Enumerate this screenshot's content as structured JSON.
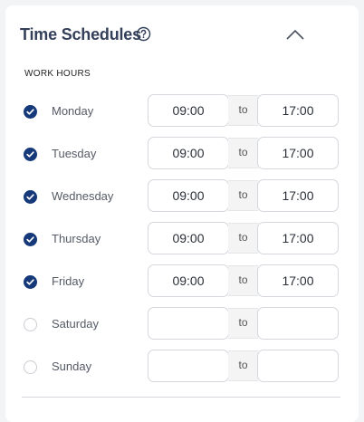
{
  "header": {
    "title": "Time Schedules"
  },
  "icons": {
    "help": "help-circle-icon",
    "collapse": "chevron-up-icon"
  },
  "section_label": "WORK HOURS",
  "colors": {
    "accent": "#16397a",
    "title": "#34405a"
  },
  "days": [
    {
      "name": "Monday",
      "enabled": true,
      "start": "09:00",
      "end": "17:00",
      "sep": "to"
    },
    {
      "name": "Tuesday",
      "enabled": true,
      "start": "09:00",
      "end": "17:00",
      "sep": "to"
    },
    {
      "name": "Wednesday",
      "enabled": true,
      "start": "09:00",
      "end": "17:00",
      "sep": "to"
    },
    {
      "name": "Thursday",
      "enabled": true,
      "start": "09:00",
      "end": "17:00",
      "sep": "to"
    },
    {
      "name": "Friday",
      "enabled": true,
      "start": "09:00",
      "end": "17:00",
      "sep": "to"
    },
    {
      "name": "Saturday",
      "enabled": false,
      "start": "",
      "end": "",
      "sep": "to"
    },
    {
      "name": "Sunday",
      "enabled": false,
      "start": "",
      "end": "",
      "sep": "to"
    }
  ]
}
